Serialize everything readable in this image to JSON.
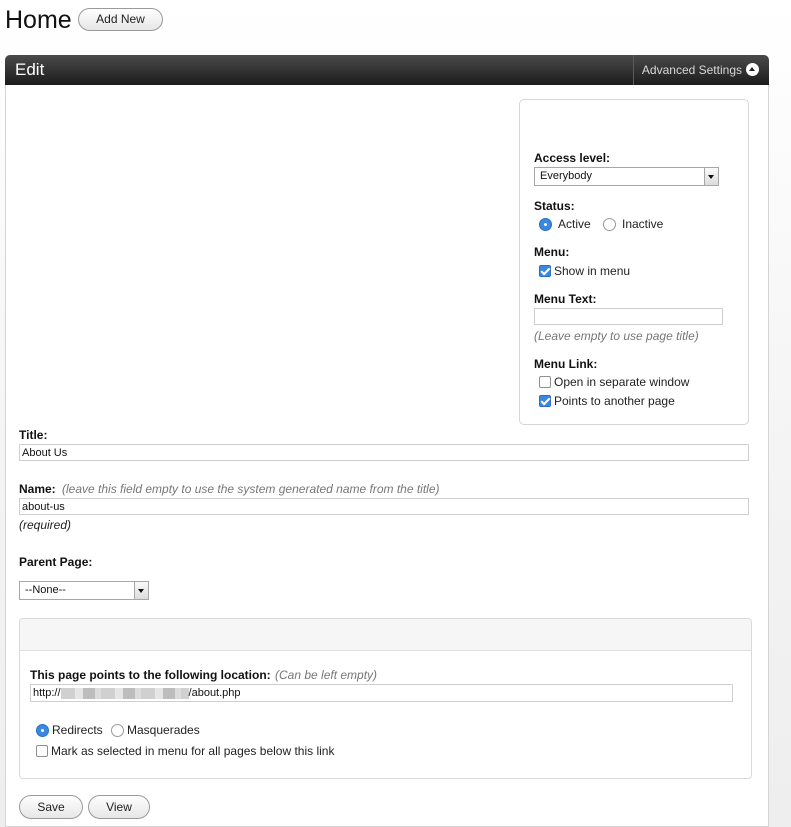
{
  "page": {
    "title": "Home",
    "add_new_label": "Add New"
  },
  "panel": {
    "title": "Edit",
    "advanced_settings_label": "Advanced Settings"
  },
  "settings": {
    "access_level_label": "Access level:",
    "access_level_value": "Everybody",
    "status_label": "Status:",
    "status_active": "Active",
    "status_inactive": "Inactive",
    "status_selected": "Active",
    "menu_label": "Menu:",
    "show_in_menu_label": "Show in menu",
    "show_in_menu_checked": true,
    "menu_text_label": "Menu Text:",
    "menu_text_value": "",
    "menu_text_hint": "(Leave empty to use page title)",
    "menu_link_label": "Menu Link:",
    "open_separate_window_label": "Open in separate window",
    "open_separate_window_checked": false,
    "points_to_another_page_label": "Points to another page",
    "points_to_another_page_checked": true
  },
  "form": {
    "title_label": "Title:",
    "title_value": "About Us",
    "name_label": "Name:",
    "name_hint": "(leave this field empty to use the system generated name from the title)",
    "name_value": "about-us",
    "name_required": "(required)",
    "parent_page_label": "Parent Page:",
    "parent_page_value": "--None--"
  },
  "location": {
    "label": "This page points to the following location:",
    "hint": "(Can be left empty)",
    "url_prefix": "http://",
    "url_suffix": "/about.php",
    "redirects_label": "Redirects",
    "masquerades_label": "Masquerades",
    "mode_selected": "Redirects",
    "mark_selected_label": "Mark as selected in menu for all pages below this link",
    "mark_selected_checked": false
  },
  "actions": {
    "save_label": "Save",
    "view_label": "View"
  },
  "colors": {
    "header_bg": "#1c1c1c",
    "accent": "#3b88e3"
  }
}
